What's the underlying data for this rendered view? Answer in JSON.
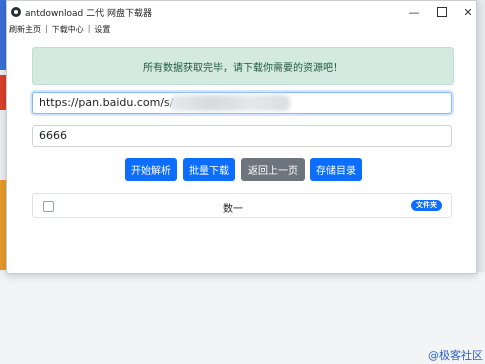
{
  "window": {
    "title": "antdownload 二代 网盘下载器",
    "controls": {
      "minimize": "—",
      "maximize": "",
      "close": "✕"
    }
  },
  "menu": {
    "items": [
      "刷新主页",
      "下载中心",
      "设置"
    ],
    "separator": "|"
  },
  "alert": {
    "text": "所有数据获取完毕，请下载你需要的资源吧！"
  },
  "inputs": {
    "url_value": "https://pan.baidu.com/s/",
    "password_value": "6666"
  },
  "buttons": {
    "parse": "开始解析",
    "batch_download": "批量下载",
    "back": "返回上一页",
    "save_dir": "存储目录"
  },
  "list": {
    "rows": [
      {
        "label": "数一",
        "badge": "文件夹",
        "checked": false
      }
    ]
  },
  "desktop": {
    "corner_text": "@极客社区"
  },
  "colors": {
    "primary": "#0d6efd",
    "secondary": "#6c757d",
    "alert_bg": "#d4e9e0"
  }
}
